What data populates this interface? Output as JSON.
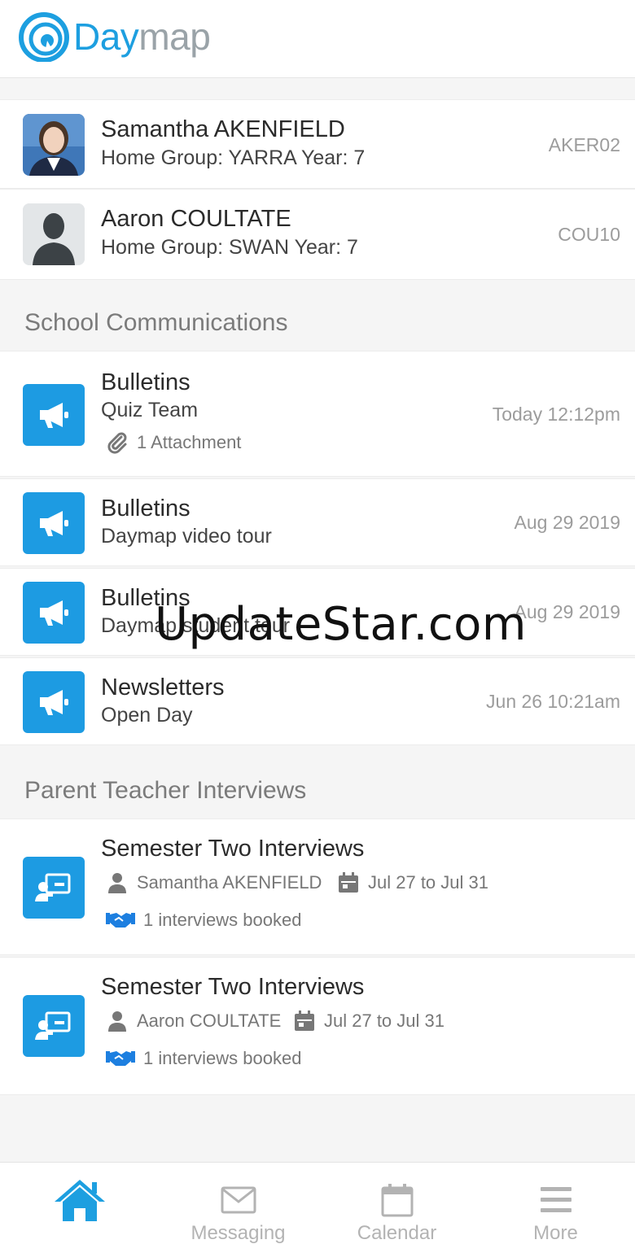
{
  "app": {
    "logo_day": "Day",
    "logo_map": "map",
    "brand_color": "#1d9fe0"
  },
  "students": [
    {
      "name": "Samantha AKENFIELD",
      "details": "Home Group: YARRA Year: 7",
      "code": "AKER02",
      "avatar": "student-photo"
    },
    {
      "name": "Aaron COULTATE",
      "details": "Home Group: SWAN Year: 7",
      "code": "COU10",
      "avatar": "placeholder-person-icon"
    }
  ],
  "communications": {
    "heading": "School Communications",
    "items": [
      {
        "category": "Bulletins",
        "title": "Quiz Team",
        "date": "Today 12:12pm",
        "attachment": "1 Attachment"
      },
      {
        "category": "Bulletins",
        "title": "Daymap video tour",
        "date": "Aug 29 2019"
      },
      {
        "category": "Bulletins",
        "title": "Daymap student tour",
        "date": "Aug 29 2019"
      },
      {
        "category": "Newsletters",
        "title": "Open Day",
        "date": "Jun 26 10:21am"
      }
    ]
  },
  "interviews": {
    "heading": "Parent Teacher Interviews",
    "items": [
      {
        "title": "Semester Two Interviews",
        "student": "Samantha AKENFIELD",
        "dates": "Jul 27 to Jul 31",
        "booked": "1 interviews booked"
      },
      {
        "title": "Semester Two Interviews",
        "student": "Aaron COULTATE",
        "dates": "Jul 27 to Jul 31",
        "booked": "1 interviews booked"
      }
    ]
  },
  "watermark": "UpdateStar.com",
  "tabs": [
    {
      "label": "",
      "icon": "home-icon",
      "active": true
    },
    {
      "label": "Messaging",
      "icon": "envelope-icon"
    },
    {
      "label": "Calendar",
      "icon": "calendar-icon"
    },
    {
      "label": "More",
      "icon": "menu-icon"
    }
  ]
}
